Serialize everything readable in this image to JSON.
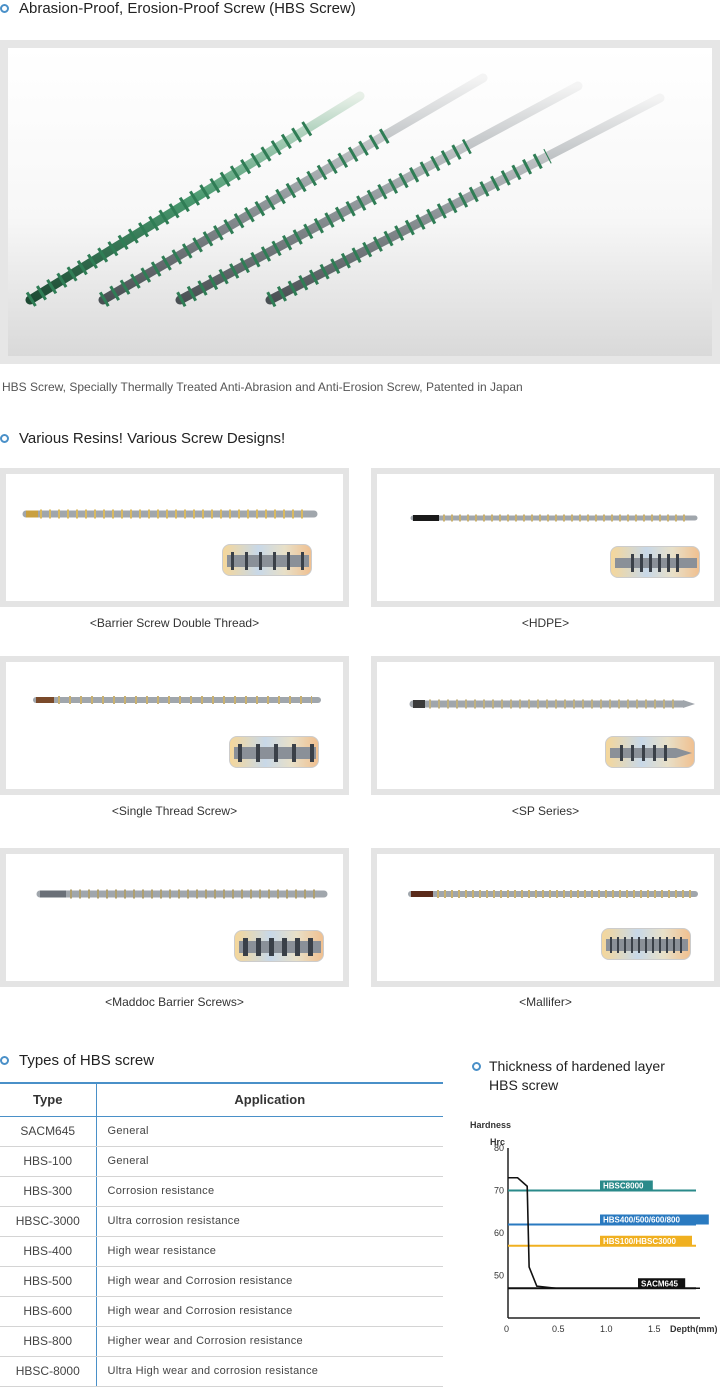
{
  "header": {
    "title": "Abrasion-Proof, Erosion-Proof Screw (HBS Screw)",
    "caption": "HBS Screw, Specially Thermally Treated Anti-Abrasion and Anti-Erosion Screw, Patented in Japan"
  },
  "designs": {
    "title": "Various Resins! Various Screw Designs!",
    "items": [
      {
        "label": "<Barrier Screw Double Thread>"
      },
      {
        "label": "<HDPE>"
      },
      {
        "label": "<Single Thread Screw>"
      },
      {
        "label": "<SP Series>"
      },
      {
        "label": "<Maddoc Barrier Screws>"
      },
      {
        "label": "<Mallifer>"
      }
    ]
  },
  "types_table": {
    "title": "Types of HBS screw",
    "headers": {
      "type": "Type",
      "application": "Application"
    },
    "rows": [
      {
        "type": "SACM645",
        "application": "General"
      },
      {
        "type": "HBS-100",
        "application": "General"
      },
      {
        "type": "HBS-300",
        "application": "Corrosion resistance"
      },
      {
        "type": "HBSC-3000",
        "application": "Ultra corrosion resistance"
      },
      {
        "type": "HBS-400",
        "application": "High wear resistance"
      },
      {
        "type": "HBS-500",
        "application": "High wear and Corrosion resistance"
      },
      {
        "type": "HBS-600",
        "application": "High wear and Corrosion resistance"
      },
      {
        "type": "HBS-800",
        "application": "Higher wear and Corrosion resistance"
      },
      {
        "type": "HBSC-8000",
        "application": "Ultra High wear and corrosion resistance"
      }
    ]
  },
  "hardness": {
    "title_line1": "Thickness of hardened layer",
    "title_line2": "HBS screw",
    "chart_data": {
      "type": "line",
      "ylabel": "Hardness",
      "yunit": "Hrc",
      "xlabel": "Depth(mm)",
      "yticks": [
        "80",
        "70",
        "60",
        "50"
      ],
      "xticks": [
        "0",
        "0.5",
        "1.0",
        "1.5"
      ],
      "ylim": [
        40,
        80
      ],
      "xlim": [
        0,
        2.0
      ],
      "series": [
        {
          "name": "HBSC8000",
          "value": 70,
          "color": "#2a8a8a"
        },
        {
          "name": "HBS400/500/600/800",
          "value": 62,
          "color": "#2a7ac0"
        },
        {
          "name": "HBS100/HBSC3000",
          "value": 57,
          "color": "#f0b020"
        },
        {
          "name": "SACM645",
          "value": 47,
          "color": "#111111"
        }
      ],
      "curve": {
        "x": [
          0,
          0.1,
          0.2,
          0.22,
          0.3,
          0.5,
          2.0
        ],
        "y": [
          73,
          73,
          71,
          52,
          47.5,
          47,
          47
        ]
      }
    }
  },
  "colors": {
    "accent": "#4a90c8"
  }
}
